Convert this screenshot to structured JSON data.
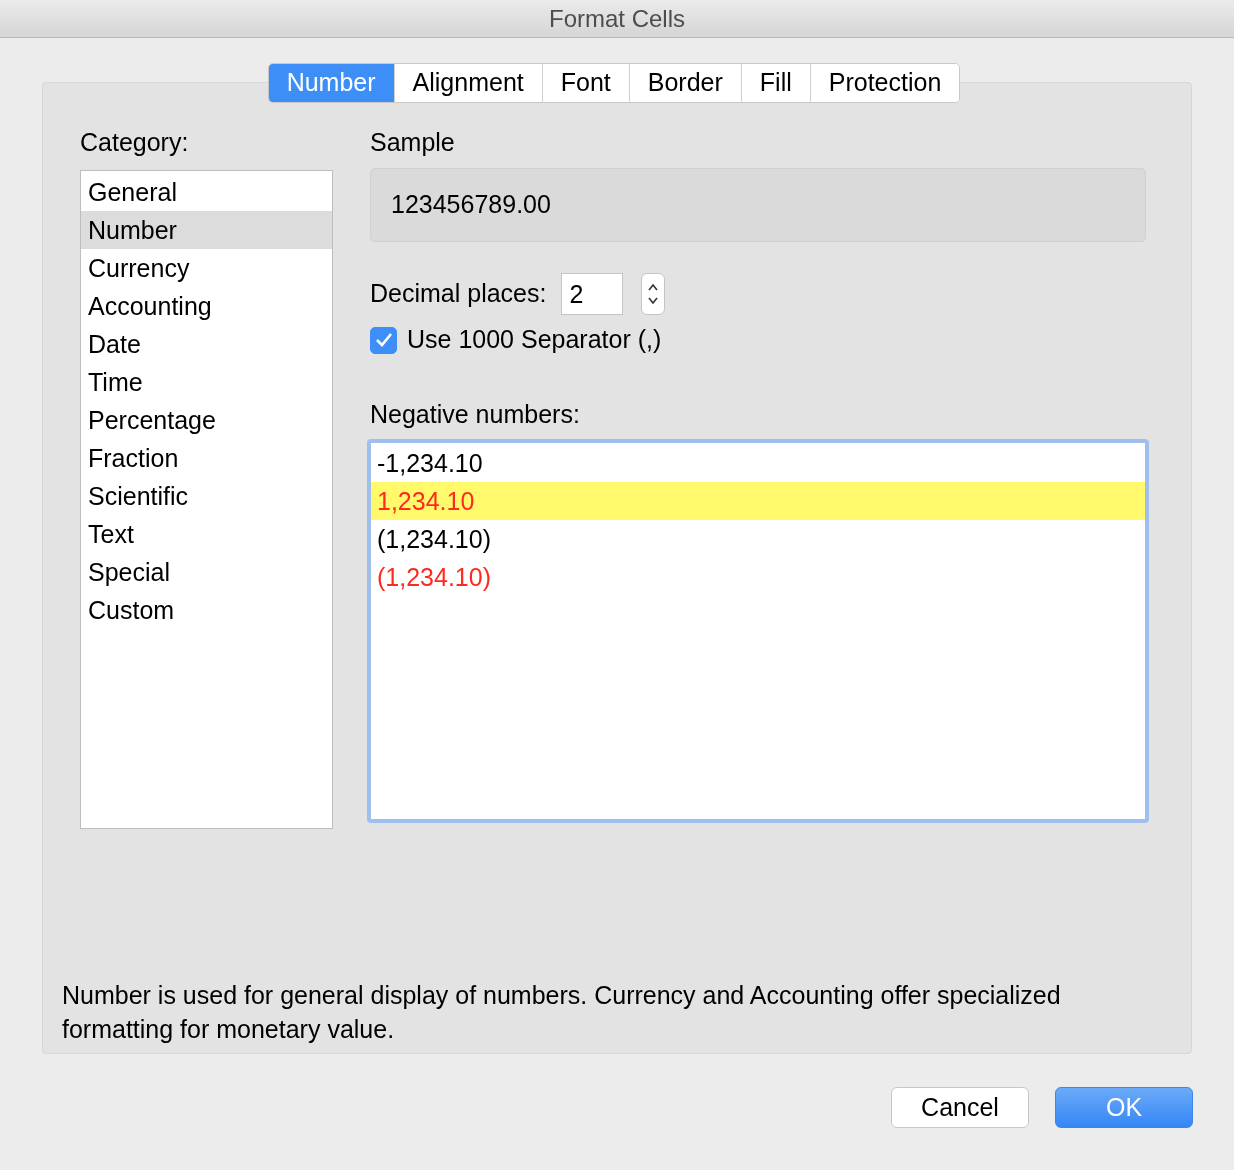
{
  "window": {
    "title": "Format Cells"
  },
  "tabs": [
    {
      "label": "Number",
      "selected": true
    },
    {
      "label": "Alignment",
      "selected": false
    },
    {
      "label": "Font",
      "selected": false
    },
    {
      "label": "Border",
      "selected": false
    },
    {
      "label": "Fill",
      "selected": false
    },
    {
      "label": "Protection",
      "selected": false
    }
  ],
  "category": {
    "label": "Category:",
    "items": [
      {
        "label": "General",
        "selected": false
      },
      {
        "label": "Number",
        "selected": true
      },
      {
        "label": "Currency",
        "selected": false
      },
      {
        "label": "Accounting",
        "selected": false
      },
      {
        "label": "Date",
        "selected": false
      },
      {
        "label": "Time",
        "selected": false
      },
      {
        "label": "Percentage",
        "selected": false
      },
      {
        "label": "Fraction",
        "selected": false
      },
      {
        "label": "Scientific",
        "selected": false
      },
      {
        "label": "Text",
        "selected": false
      },
      {
        "label": "Special",
        "selected": false
      },
      {
        "label": "Custom",
        "selected": false
      }
    ]
  },
  "sample": {
    "label": "Sample",
    "value": "123456789.00"
  },
  "decimal_places": {
    "label": "Decimal places:",
    "value": "2"
  },
  "separator": {
    "label": "Use 1000 Separator (,)",
    "checked": true
  },
  "negative_numbers": {
    "label": "Negative numbers:",
    "items": [
      {
        "label": "-1,234.10",
        "color": "#000000",
        "selected": false
      },
      {
        "label": "1,234.10",
        "color": "#ff2a1f",
        "selected": true
      },
      {
        "label": "(1,234.10)",
        "color": "#000000",
        "selected": false
      },
      {
        "label": "(1,234.10)",
        "color": "#ff2a1f",
        "selected": false
      }
    ]
  },
  "description": "Number is used for general display of numbers.  Currency and Accounting offer specialized formatting for monetary value.",
  "buttons": [
    {
      "label": "Cancel",
      "kind": "secondary"
    },
    {
      "label": "OK",
      "kind": "primary"
    }
  ]
}
